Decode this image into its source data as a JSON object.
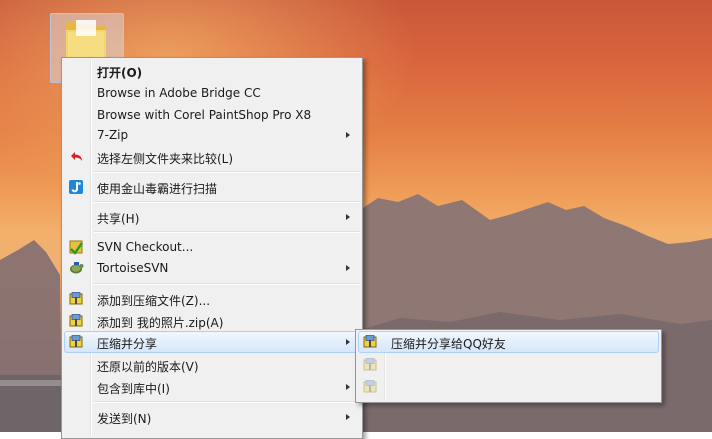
{
  "context_menu": {
    "items": [
      {
        "label": "打开(O)",
        "bold": true,
        "icon": "none"
      },
      {
        "label": "Browse in Adobe Bridge CC",
        "icon": "none"
      },
      {
        "label": "Browse with Corel PaintShop Pro X8",
        "icon": "none"
      },
      {
        "label": "7-Zip",
        "icon": "none",
        "submenu": true
      },
      {
        "label": "选择左侧文件夹来比较(L)",
        "icon": "red-undo-arrow-icon"
      },
      {
        "label": "使用金山毒霸进行扫描",
        "icon": "kingsoft-antivirus-icon"
      },
      {
        "label": "共享(H)",
        "icon": "none",
        "submenu": true
      },
      {
        "label": "SVN Checkout...",
        "icon": "svn-checkout-icon"
      },
      {
        "label": "TortoiseSVN",
        "icon": "tortoise-icon",
        "submenu": true
      },
      {
        "label": "添加到压缩文件(Z)...",
        "icon": "archive-icon"
      },
      {
        "label": "添加到 我的照片.zip(A)",
        "icon": "archive-icon"
      },
      {
        "label": "压缩并分享",
        "icon": "archive-icon",
        "submenu": true,
        "highlighted": true
      },
      {
        "label": "还原以前的版本(V)",
        "icon": "none"
      },
      {
        "label": "包含到库中(I)",
        "icon": "none",
        "submenu": true
      },
      {
        "label": "发送到(N)",
        "icon": "none",
        "submenu": true
      }
    ]
  },
  "share_submenu": {
    "items": [
      {
        "label": "压缩并分享给QQ好友",
        "icon": "archive-icon",
        "highlighted": true,
        "enabled": true
      },
      {
        "label": "",
        "icon": "archive-icon",
        "enabled": false
      },
      {
        "label": "",
        "icon": "archive-icon",
        "enabled": false
      }
    ]
  },
  "colors": {
    "menu_bg": "#f0f0f0",
    "highlight_border": "#aecff7",
    "highlight_fill": "#dde9f9",
    "folder_yellow": "#f2cf5e"
  }
}
